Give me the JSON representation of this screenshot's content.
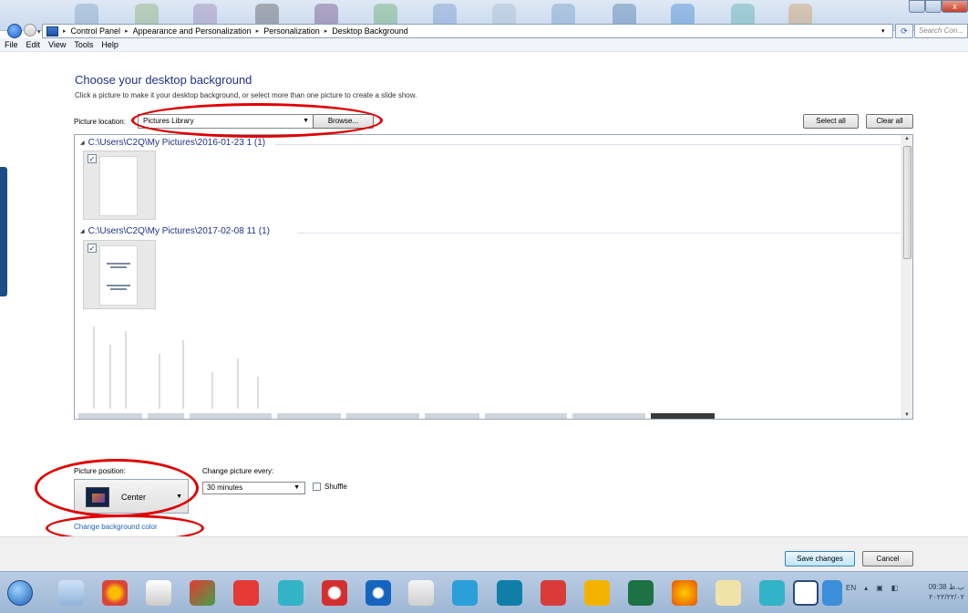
{
  "window": {
    "breadcrumbs": [
      "Control Panel",
      "Appearance and Personalization",
      "Personalization",
      "Desktop Background"
    ],
    "search_placeholder": "Search Con...",
    "close_glyph": "x"
  },
  "menu": [
    "File",
    "Edit",
    "View",
    "Tools",
    "Help"
  ],
  "page": {
    "title": "Choose your desktop background",
    "subtitle": "Click a picture to make it your desktop background, or select more than one picture to create a slide show.",
    "picture_location_label": "Picture location:",
    "picture_location_value": "Pictures Library",
    "browse_label": "Browse...",
    "select_all_label": "Select all",
    "clear_all_label": "Clear all"
  },
  "gallery": {
    "groups": [
      {
        "path": "C:\\Users\\C2Q\\My Pictures\\2016-01-23 1 (1)",
        "checked": true
      },
      {
        "path": "C:\\Users\\C2Q\\My Pictures\\2017-02-08 11 (1)",
        "checked": true
      }
    ]
  },
  "options": {
    "position_label": "Picture position:",
    "position_value": "Center",
    "change_every_label": "Change picture every:",
    "change_every_value": "30 minutes",
    "shuffle_label": "Shuffle",
    "shuffle_checked": false,
    "background_color_link": "Change background color"
  },
  "footer": {
    "save_label": "Save changes",
    "cancel_label": "Cancel"
  },
  "taskbar": {
    "tray_lang": "EN",
    "clock_time": "09:38 ب.ظ",
    "clock_date": "۲۰۲۲/۲۲/۰۲"
  },
  "colors": {
    "heading_blue": "#1e3287",
    "link_blue": "#1e62b8",
    "annotation_red": "#e00000"
  }
}
